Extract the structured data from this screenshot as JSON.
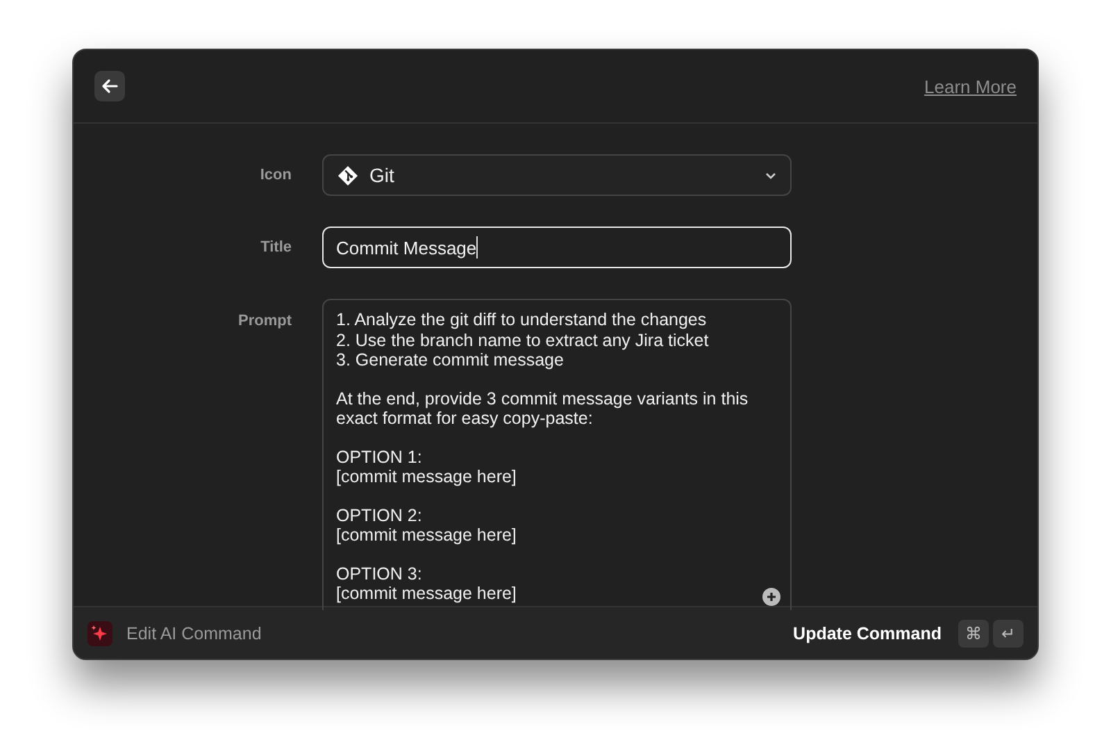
{
  "header": {
    "link": "Learn More"
  },
  "form": {
    "icon": {
      "label": "Icon",
      "value": "Git"
    },
    "title": {
      "label": "Title",
      "value": "Commit Message",
      "focused": true
    },
    "prompt": {
      "label": "Prompt",
      "paragraphs": [
        [
          "1. Analyze the git diff to understand the changes",
          "2. Use the branch name to extract any Jira ticket",
          "3. Generate commit message"
        ],
        [
          "At the end, provide 3 commit message variants in this",
          "exact format for easy copy-paste:"
        ],
        [
          "OPTION 1:",
          "[commit message here]"
        ],
        [
          "OPTION 2:",
          "[commit message here]"
        ],
        [
          "OPTION 3:",
          "[commit message here]"
        ]
      ]
    }
  },
  "footer": {
    "title": "Edit AI Command",
    "action": "Update Command",
    "keys": [
      "⌘",
      "↵"
    ]
  }
}
